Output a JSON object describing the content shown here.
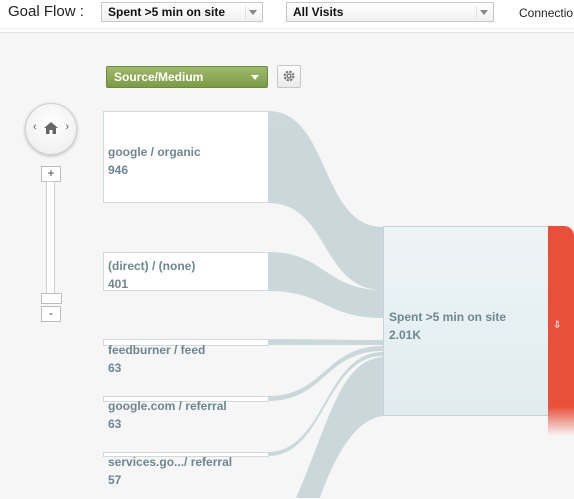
{
  "toolbar": {
    "title": "Goal Flow",
    "goal_select": "Spent >5 min on site",
    "segment_select": "All Visits",
    "connections_label": "Connectio"
  },
  "canvas": {
    "dimension_select": "Source/Medium",
    "settings_icon": "gear-icon",
    "home_icon": "home-icon",
    "zoom_in_label": "+",
    "zoom_out_label": "-"
  },
  "sources": [
    {
      "label": "google / organic",
      "count": "946"
    },
    {
      "label": "(direct) / (none)",
      "count": "401"
    },
    {
      "label": "feedburner / feed",
      "count": "63"
    },
    {
      "label": "google.com / referral",
      "count": "63"
    },
    {
      "label": "services.go.../ referral",
      "count": "57"
    }
  ],
  "goal": {
    "label": "Spent >5 min on site",
    "count": "2.01K",
    "exit_icon": "down-arrow-icon"
  },
  "colors": {
    "flow": "#c9d7da",
    "dimension_green": "#8aab55",
    "exit_red": "#e8503a",
    "node_text": "#6e8690"
  }
}
